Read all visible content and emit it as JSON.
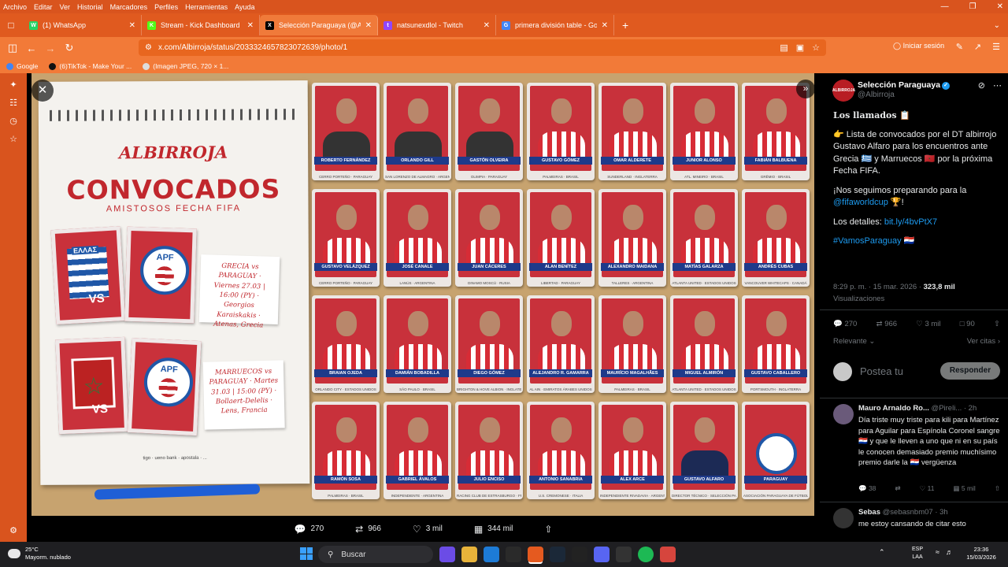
{
  "menu": [
    "Archivo",
    "Editar",
    "Ver",
    "Historial",
    "Marcadores",
    "Perfiles",
    "Herramientas",
    "Ayuda"
  ],
  "tabs": [
    {
      "title": "(1) WhatsApp",
      "color": "#25d366",
      "glyph": "W"
    },
    {
      "title": "Stream - Kick Dashboard",
      "color": "#53fc18",
      "glyph": "K"
    },
    {
      "title": "Selección Paraguaya (@Albirroja",
      "color": "#000000",
      "glyph": "X"
    },
    {
      "title": "natsunexdlol - Twitch",
      "color": "#9146ff",
      "glyph": "t"
    },
    {
      "title": "primera división table - Google",
      "color": "#4285f4",
      "glyph": "G"
    }
  ],
  "url": "x.com/Albirroja/status/2033324657823072639/photo/1",
  "signin": "Iniciar sesión",
  "bookmarks": [
    "Google",
    "(6)TikTok - Make Your ...",
    "(Imagen JPEG, 720 × 1..."
  ],
  "graphic": {
    "brand": "ALBIRROJA",
    "title": "CONVOCADOS",
    "subtitle": "AMISTOSOS FECHA FIFA",
    "greece_flag_text": "ΕΛΛΑΣ",
    "apf": "APF",
    "vs": "VS",
    "match1": "GRECIA vs PARAGUAY · Viernes 27.03 | 16:00 (PY) · Georgios Karaiskakis · Atenas, Grecia",
    "match2": "MARRUECOS vs PARAGUAY · Martes 31.03 | 15:00 (PY) · Bollaert-Delelis · Lens, Francia",
    "sponsors": "tigo · ueno bank · apostala · ..."
  },
  "players": [
    {
      "name": "ROBERTO FERNÁNDEZ",
      "club": "CERRO PORTEÑO · PARAGUAY",
      "kind": "gk"
    },
    {
      "name": "ORLANDO GILL",
      "club": "SAN LORENZO DE ALMAGRO · ARGENTINA",
      "kind": "gk"
    },
    {
      "name": "GASTÓN OLVEIRA",
      "club": "OLIMPIA · PARAGUAY",
      "kind": "gk"
    },
    {
      "name": "GUSTAVO GÓMEZ",
      "club": "PALMEIRAS · BRASIL",
      "kind": "p"
    },
    {
      "name": "OMAR ALDERETE",
      "club": "SUNDERLAND · INGLATERRA",
      "kind": "p"
    },
    {
      "name": "JUNIOR ALONSO",
      "club": "ATL. MINEIRO · BRASIL",
      "kind": "p"
    },
    {
      "name": "FABIÁN BALBUENA",
      "club": "GRÊMIO · BRASIL",
      "kind": "p"
    },
    {
      "name": "GUSTAVO VELÁZQUEZ",
      "club": "CERRO PORTEÑO · PARAGUAY",
      "kind": "p"
    },
    {
      "name": "JOSÉ CANALE",
      "club": "LANÚS · ARGENTINA",
      "kind": "p"
    },
    {
      "name": "JUAN CÁCERES",
      "club": "DINAMO MOSCÚ · RUSIA",
      "kind": "p"
    },
    {
      "name": "ALAN BENÍTEZ",
      "club": "LIBERTAD · PARAGUAY",
      "kind": "p"
    },
    {
      "name": "ALEXANDRO MAIDANA",
      "club": "TALLERES · ARGENTINA",
      "kind": "p"
    },
    {
      "name": "MATÍAS GALARZA",
      "club": "ATLANTA UNITED · ESTADOS UNIDOS",
      "kind": "p"
    },
    {
      "name": "ANDRÉS CUBAS",
      "club": "VANCOUVER WHITECAPS · CANADÁ",
      "kind": "p"
    },
    {
      "name": "BRAIAN OJEDA",
      "club": "ORLANDO CITY · ESTADOS UNIDOS",
      "kind": "p"
    },
    {
      "name": "DAMIÁN BOBADILLA",
      "club": "SÃO PAULO · BRASIL",
      "kind": "p"
    },
    {
      "name": "DIEGO GÓMEZ",
      "club": "BRIGHTON & HOVE ALBION · INGLATERRA",
      "kind": "p"
    },
    {
      "name": "ALEJANDRO R. GAMARRA",
      "club": "AL AIN · EMIRATOS ÁRABES UNIDOS",
      "kind": "p"
    },
    {
      "name": "MAURÍCIO MAGALHÃES",
      "club": "PALMEIRAS · BRASIL",
      "kind": "p"
    },
    {
      "name": "MIGUEL ALMIRÓN",
      "club": "ATLANTA UNITED · ESTADOS UNIDOS",
      "kind": "p"
    },
    {
      "name": "GUSTAVO CABALLERO",
      "club": "PORTSMOUTH · INGLATERRA",
      "kind": "p"
    },
    {
      "name": "RAMÓN SOSA",
      "club": "PALMEIRAS · BRASIL",
      "kind": "p"
    },
    {
      "name": "GABRIEL ÁVALOS",
      "club": "INDEPENDIENTE · ARGENTINA",
      "kind": "p"
    },
    {
      "name": "JULIO ENCISO",
      "club": "RACING CLUB DE ESTRASBURGO · FRANCIA",
      "kind": "p"
    },
    {
      "name": "ANTONIO SANABRIA",
      "club": "U.S. CREMONESE · ITALIA",
      "kind": "p"
    },
    {
      "name": "ALEX ARCE",
      "club": "INDEPENDIENTE RIVADAVIA · ARGENTINA",
      "kind": "p"
    },
    {
      "name": "GUSTAVO ALFARO",
      "club": "DIRECTOR TÉCNICO · SELECCIÓN PARAGUAYA",
      "kind": "coach"
    },
    {
      "name": "PARAGUAY",
      "club": "ASOCIACIÓN PARAGUAYA DE FÚTBOL",
      "kind": "crest"
    }
  ],
  "mediabar": {
    "replies": "270",
    "reposts": "966",
    "likes": "3 mil",
    "views": "344 mil"
  },
  "tweet": {
    "author": "Selección Paraguaya",
    "handle": "@Albirroja",
    "avatar_text": "ALBIRROJA",
    "heading": "Los llamados 📋",
    "p1": "👉 Lista de convocados por el DT albirrojo Gustavo Alfaro para los encuentros ante Grecia 🇬🇷 y Marruecos 🇲🇦 por la próxima Fecha FIFA.",
    "p2a": "¡Nos seguimos preparando para la ",
    "p2link": "@fifaworldcup",
    "p2b": " 🏆!",
    "p3a": "Los detalles: ",
    "p3link": "bit.ly/4bvPtX7",
    "hashtag": "#VamosParaguay 🇵🇾",
    "time": "8:29 p. m. · 15 mar. 2026 · ",
    "views": "323,8 mil",
    "views_label": "Visualizaciones",
    "stats": {
      "replies": "270",
      "reposts": "966",
      "likes": "3 mil",
      "bookmarks": "90"
    },
    "sort": "Relevante",
    "quotes": "Ver citas",
    "reply_placeholder": "Postea tu",
    "reply_button": "Responder"
  },
  "replies": [
    {
      "name": "Mauro Arnaldo Ro...",
      "handle": "@Pireli...",
      "time": "· 2h",
      "text": "Día triste muy triste para kili para Martínez para Aguilar para Espínola Coronel sangre 🇵🇾 y que le lleven a uno que ni en su país le conocen demasiado premio muchísimo premio darle la 🇵🇾 vergüenza",
      "replies": "38",
      "reposts": "",
      "likes": "11",
      "views": "5 mil"
    },
    {
      "name": "Sebas",
      "handle": "@sebasnbm07",
      "time": "· 3h",
      "text": "me estoy cansando de citar esto"
    }
  ],
  "taskbar": {
    "temp": "25°C",
    "weather": "Mayorm. nublado",
    "search": "Buscar",
    "lang1": "ESP",
    "lang2": "LAA",
    "time": "23:36",
    "date": "15/03/2026"
  }
}
